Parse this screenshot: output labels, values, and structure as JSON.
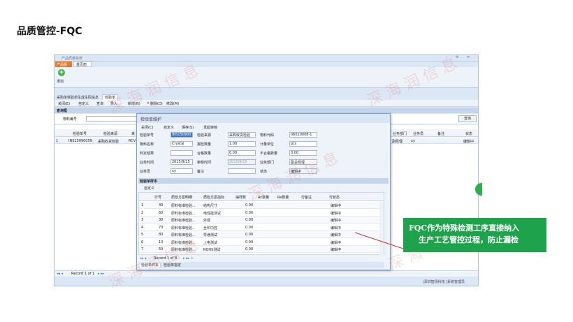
{
  "page_title": "品质管控-FQC",
  "app": {
    "window_title": "产品质量系统",
    "tabs": [
      "产品版",
      "首页册"
    ],
    "add_label": "添加",
    "module_tabs": [
      "采购单转验单生成",
      "生码信息",
      "检验单"
    ],
    "toolbar": [
      "关闭(E)",
      "自定义",
      "查询",
      "导入",
      "新增(N)",
      "删除(D)",
      "修改(M)"
    ],
    "query_label": "查询框",
    "material_label": "物料编号",
    "query_button": "查询",
    "grid_headers": [
      "检验单号",
      "检验来源",
      "来",
      "",
      "业务部门",
      "业务员",
      "备注",
      "状态"
    ],
    "grid_row": {
      "index": "1",
      "no": "INS15090059",
      "src": "采购收货检验",
      "extra": "RCV",
      "dept": "副经理",
      "staff": "xy",
      "status": "编辑中"
    },
    "status_bar": "Record 1 of 1",
    "status_right": "|深圳智扬科技 |系统管理员"
  },
  "dialog": {
    "title": "检验单维护",
    "toolbar": [
      "关闭(C)",
      "自定义",
      "保存(S)",
      "发起审核"
    ],
    "fields": [
      {
        "label": "检验单号",
        "value": "INS150900"
      },
      {
        "label": "物料名称",
        "value": "Crystal"
      },
      {
        "label": "判定结果",
        "value": ""
      },
      {
        "label": "业务时间",
        "value": "2015/9/15"
      },
      {
        "label": "业务员",
        "value": "xy"
      }
    ],
    "fields2": [
      {
        "label": "检验来源",
        "value": "采购收货检验"
      },
      {
        "label": "报检数量",
        "value": "1.00"
      },
      {
        "label": "合格数量",
        "value": "0.00"
      },
      {
        "label": "审核时间",
        "value": "2015/9/15"
      },
      {
        "label": "备注",
        "value": ""
      }
    ],
    "fields3": [
      {
        "label": "物料代码",
        "value": "06010008-1"
      },
      {
        "label": "计量单位",
        "value": "pcs"
      },
      {
        "label": "不合格数量",
        "value": "0.00"
      },
      {
        "label": "业务部门",
        "value": "副总经理"
      },
      {
        "label": "状态",
        "value": "编辑中"
      }
    ],
    "sub_title": "检验单样本",
    "sub_toolbar": "自定义",
    "table_headers": [
      "",
      "行号",
      "质检方案明细",
      "质检方案指标",
      "抽样数",
      "Ac数量",
      "Re数量",
      "行备注",
      "行状态"
    ],
    "table_rows": [
      {
        "i": "1",
        "no": "40",
        "detail": "原料标准检验...",
        "index": "结构尺寸",
        "qty": "0.00",
        "status": "编辑中"
      },
      {
        "i": "2",
        "no": "60",
        "detail": "原料标准检验...",
        "index": "电性能测试",
        "qty": "0.00",
        "status": "编辑中"
      },
      {
        "i": "3",
        "no": "30",
        "detail": "原料标准检验...",
        "index": "外观",
        "qty": "0.00",
        "status": "编辑中"
      },
      {
        "i": "4",
        "no": "70",
        "detail": "原料标准检验...",
        "index": "丝印内容",
        "qty": "0.00",
        "status": "编辑中"
      },
      {
        "i": "5",
        "no": "80",
        "detail": "原料标准检验...",
        "index": "导通测试",
        "qty": "0.00",
        "status": "编辑中"
      },
      {
        "i": "6",
        "no": "10",
        "detail": "原料标准检验...",
        "index": "上电测试",
        "qty": "0.00",
        "status": "编辑中"
      },
      {
        "i": "7",
        "no": "50",
        "detail": "原料标准检验...",
        "index": "ROHS测试",
        "qty": "0.00",
        "status": "编辑中"
      }
    ],
    "record_text": "Record 1 of 8",
    "bottom_tabs": [
      "检验单样本",
      "检验单指定"
    ]
  },
  "watermark": "深 海 润 信 息",
  "callout": [
    "FQC作为特殊检测工序直接纳入",
    "生产工艺管控过程，防止漏检"
  ],
  "colors": {
    "callout": "#1ea24c",
    "header": "#c5d6ec",
    "selected": "#3d78c4"
  }
}
